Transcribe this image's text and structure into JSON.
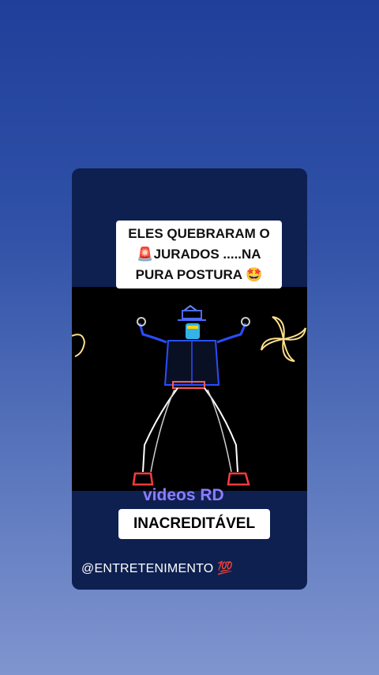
{
  "story": {
    "caption_line1": "ELES QUEBRARAM O",
    "caption_line2_icon": "🚨",
    "caption_line2": "JURADOS .....NA",
    "caption_line3": "PURA POSTURA",
    "caption_line3_icon": "🤩",
    "watermark": "videos RD",
    "tag_label": "INACREDITÁVEL",
    "handle": "@ENTRETENIMENTO",
    "handle_icon": "💯"
  },
  "colors": {
    "background_top": "#1f3f9a",
    "background_bottom": "#7f95cf",
    "card": "#0e2050",
    "watermark": "#8d7cff",
    "neon_suit": "#2a4dff",
    "neon_accent": "#ffe08a"
  },
  "icons": {
    "siren": "siren-icon",
    "star_eyes": "star-struck-icon",
    "hundred": "hundred-points-icon"
  }
}
